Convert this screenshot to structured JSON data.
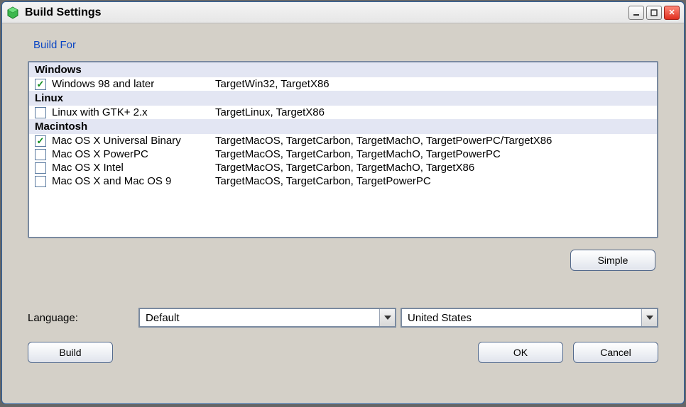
{
  "window": {
    "title": "Build Settings"
  },
  "section": {
    "build_for": "Build For"
  },
  "groups": {
    "windows": "Windows",
    "linux": "Linux",
    "macintosh": "Macintosh"
  },
  "rows": {
    "win98": {
      "label": "Windows 98 and later",
      "targets": "TargetWin32, TargetX86",
      "checked": true
    },
    "linuxgtk": {
      "label": "Linux with GTK+ 2.x",
      "targets": "TargetLinux, TargetX86",
      "checked": false
    },
    "macuniversal": {
      "label": "Mac OS X Universal Binary",
      "targets": "TargetMacOS, TargetCarbon, TargetMachO, TargetPowerPC/TargetX86",
      "checked": true
    },
    "macppc": {
      "label": "Mac OS X PowerPC",
      "targets": "TargetMacOS, TargetCarbon, TargetMachO, TargetPowerPC",
      "checked": false
    },
    "macintel": {
      "label": "Mac OS X Intel",
      "targets": "TargetMacOS, TargetCarbon, TargetMachO, TargetX86",
      "checked": false
    },
    "macos9": {
      "label": "Mac OS X and Mac OS 9",
      "targets": "TargetMacOS, TargetCarbon, TargetPowerPC",
      "checked": false
    }
  },
  "buttons": {
    "simple": "Simple",
    "build": "Build",
    "ok": "OK",
    "cancel": "Cancel"
  },
  "language": {
    "label": "Language:",
    "value1": "Default",
    "value2": "United States"
  },
  "checkmark": "✓"
}
